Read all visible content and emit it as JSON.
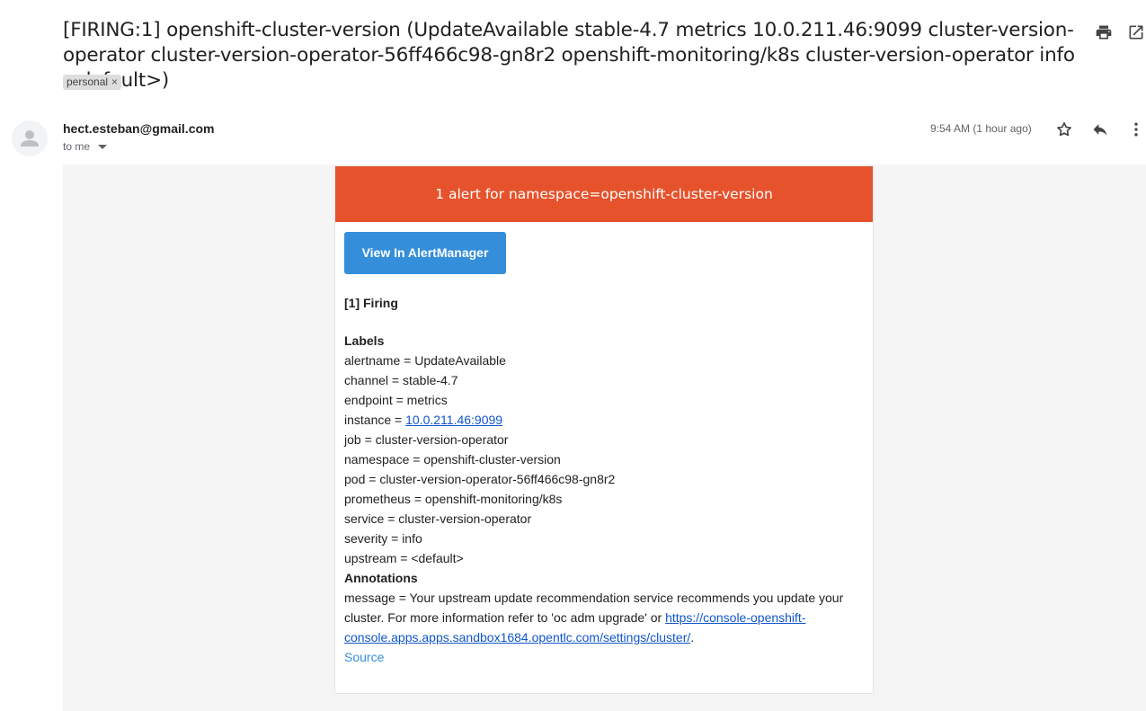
{
  "email": {
    "subject": "[FIRING:1] openshift-cluster-version (UpdateAvailable stable-4.7 metrics 10.0.211.46:9099 cluster-version-operator cluster-version-operator-56ff466c98-gn8r2 openshift-monitoring/k8s cluster-version-operator info <default>)",
    "label": "personal",
    "label_remove": "×",
    "sender": "hect.esteban@gmail.com",
    "recipient": "to me",
    "timestamp": "9:54 AM (1 hour ago)"
  },
  "icons": [
    "print-icon",
    "open-in-new-window-icon",
    "avatar-icon",
    "chevron-down-icon",
    "star-icon",
    "reply-icon",
    "more-vert-icon"
  ],
  "alert": {
    "banner": "1 alert for namespace=openshift-cluster-version",
    "banner_color": "#e6522c",
    "button_label": "View In AlertManager",
    "button_color": "#348eda",
    "firing_heading": "[1] Firing",
    "labels_heading": "Labels",
    "labels": [
      "alertname = UpdateAvailable",
      "channel = stable-4.7",
      "endpoint = metrics",
      "job = cluster-version-operator",
      "namespace = openshift-cluster-version",
      "pod = cluster-version-operator-56ff466c98-gn8r2",
      "prometheus = openshift-monitoring/k8s",
      "service = cluster-version-operator",
      "severity = info",
      "upstream = <default>"
    ],
    "instance_prefix": "instance = ",
    "instance_link": "10.0.211.46:9099",
    "annotations_heading": "Annotations",
    "message_text": "message = Your upstream update recommendation service recommends you update your cluster. For more information refer to 'oc adm upgrade' or ",
    "message_link": "https://console-openshift-console.apps.apps.sandbox1684.opentlc.com/settings/cluster/",
    "message_end": ".",
    "source_link": "Source"
  }
}
